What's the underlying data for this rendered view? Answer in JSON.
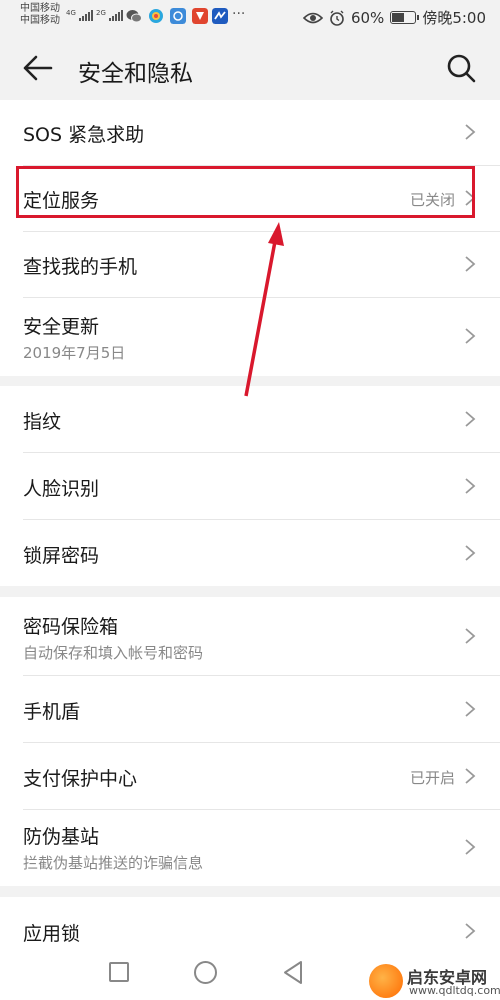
{
  "status_bar": {
    "carrier_1": "中国移动",
    "carrier_2": "中国移动",
    "network_1": "4G",
    "network_2": "2G",
    "more": "···",
    "battery_percent": "60%",
    "battery_level": 0.6,
    "time": "傍晚5:00"
  },
  "header": {
    "title": "安全和隐私"
  },
  "rows": {
    "sos": {
      "label": "SOS 紧急求助"
    },
    "location": {
      "label": "定位服务",
      "value": "已关闭"
    },
    "find_phone": {
      "label": "查找我的手机"
    },
    "security_update": {
      "label": "安全更新",
      "sub": "2019年7月5日"
    },
    "fingerprint": {
      "label": "指纹"
    },
    "face_id": {
      "label": "人脸识别"
    },
    "lock_password": {
      "label": "锁屏密码"
    },
    "password_vault": {
      "label": "密码保险箱",
      "sub": "自动保存和填入帐号和密码"
    },
    "phone_shield": {
      "label": "手机盾"
    },
    "payment_protection": {
      "label": "支付保护中心",
      "value": "已开启"
    },
    "anti_fake_station": {
      "label": "防伪基站",
      "sub": "拦截伪基站推送的诈骗信息"
    },
    "app_lock": {
      "label": "应用锁"
    }
  },
  "watermark": {
    "name": "启东安卓网",
    "url": "www.qdltdq.com"
  },
  "colors": {
    "highlight": "#d9182d",
    "background": "#f2f2f2",
    "card": "#ffffff",
    "secondary_text": "#888888"
  }
}
